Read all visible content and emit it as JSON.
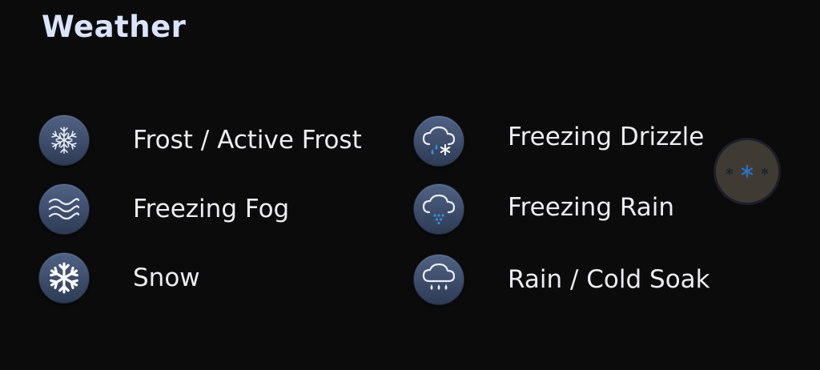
{
  "header": {
    "title": "Weather"
  },
  "items": [
    {
      "label": "Frost / Active Frost",
      "icon": "snowflake-outline-icon"
    },
    {
      "label": "Freezing Fog",
      "icon": "fog-waves-icon"
    },
    {
      "label": "Snow",
      "icon": "snowflake-icon"
    },
    {
      "label": "Freezing Drizzle",
      "icon": "cloud-drizzle-snow-icon"
    },
    {
      "label": "Freezing Rain",
      "icon": "cloud-rain-icon"
    },
    {
      "label": "Rain / Cold Soak",
      "icon": "cloud-rain-drops-icon"
    }
  ],
  "floating_button": {
    "icon": "snow-stars-icon"
  },
  "colors": {
    "background": "#0b0b0b",
    "title": "#dbe4ff",
    "icon_bg": "#3d4e6e",
    "accent_blue": "#3a8fd8"
  }
}
